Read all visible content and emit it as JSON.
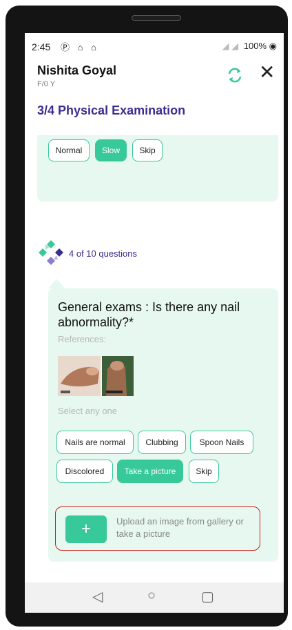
{
  "status_bar": {
    "time": "2:45",
    "left_icons": "Ⓟ ⌂ ⌂",
    "battery": "100%",
    "battery_icon": "◉",
    "signal_icons": "◢ ◢"
  },
  "header": {
    "patient_name": "Nishita Goyal",
    "patient_meta": "F/0 Y",
    "section_title": "3/4 Physical Examination",
    "close_icon": "✕"
  },
  "prev_question": {
    "options": [
      {
        "label": "Normal",
        "selected": false
      },
      {
        "label": "Slow",
        "selected": true
      },
      {
        "label": "Skip",
        "selected": false
      }
    ]
  },
  "progress": {
    "label": "4 of 10 questions"
  },
  "question": {
    "text": "General exams : Is there any nail abnormality?*",
    "references_label": "References:",
    "select_label": "Select any one",
    "options": [
      {
        "label": "Nails are normal",
        "selected": false
      },
      {
        "label": "Clubbing",
        "selected": false
      },
      {
        "label": "Spoon Nails",
        "selected": false
      },
      {
        "label": "Discolored",
        "selected": false
      },
      {
        "label": "Take a picture",
        "selected": true
      },
      {
        "label": "Skip",
        "selected": false
      }
    ]
  },
  "upload": {
    "plus": "+",
    "text": "Upload an image from gallery or take a picture"
  },
  "navbar": {
    "back": "◁",
    "home": "○",
    "recents": "▢"
  },
  "colors": {
    "accent": "#38c99a",
    "title": "#3a2d8f",
    "card_bg": "#e6f8ef",
    "highlight_border": "#cc1d1d"
  }
}
